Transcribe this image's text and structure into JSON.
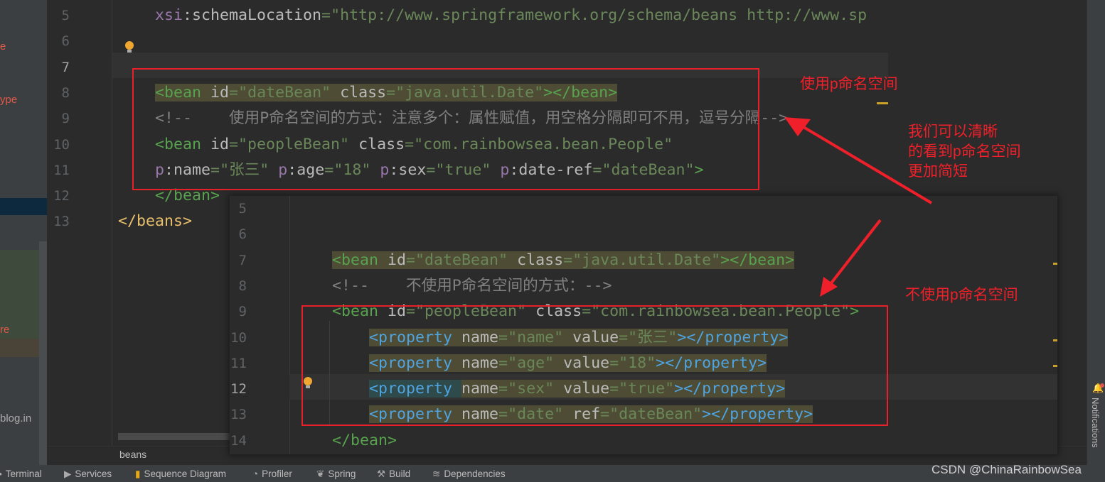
{
  "sidebar": {
    "fragments": [
      "e",
      "ype",
      "re",
      "blog.in"
    ]
  },
  "editor": {
    "line_numbers": [
      "5",
      "6",
      "7",
      "8",
      "9",
      "10",
      "11",
      "12",
      "13"
    ],
    "lines": [
      [
        [
          "attr",
          "    "
        ],
        [
          "ns",
          "xsi"
        ],
        [
          "attr",
          ":schemaLocation"
        ],
        [
          "eq",
          "="
        ],
        [
          "str",
          "\"http://www.springframework.org/schema/beans http://www.sp"
        ]
      ],
      [],
      [],
      [
        [
          "tag",
          "    <bean "
        ],
        [
          "attr",
          "id"
        ],
        [
          "eq",
          "="
        ],
        [
          "str",
          "\"dateBean\" "
        ],
        [
          "attr",
          "class"
        ],
        [
          "eq",
          "="
        ],
        [
          "str",
          "\"java.util.Date\""
        ],
        [
          "tag",
          "></bean>"
        ]
      ],
      [
        [
          "com",
          "    <!--    使用P命名空间的方式：注意多个：属性赋值，用空格分隔即可不用，逗号分隔-->"
        ]
      ],
      [
        [
          "tag",
          "    <bean "
        ],
        [
          "attr",
          "id"
        ],
        [
          "eq",
          "="
        ],
        [
          "str",
          "\"peopleBean\" "
        ],
        [
          "attr",
          "class"
        ],
        [
          "eq",
          "="
        ],
        [
          "str",
          "\"com.rainbowsea.bean.People\""
        ]
      ],
      [
        [
          "attr",
          "    "
        ],
        [
          "ns",
          "p"
        ],
        [
          "attr",
          ":name"
        ],
        [
          "eq",
          "="
        ],
        [
          "str",
          "\"张三\" "
        ],
        [
          "ns",
          "p"
        ],
        [
          "attr",
          ":age"
        ],
        [
          "eq",
          "="
        ],
        [
          "str",
          "\"18\" "
        ],
        [
          "ns",
          "p"
        ],
        [
          "attr",
          ":sex"
        ],
        [
          "eq",
          "="
        ],
        [
          "str",
          "\"true\" "
        ],
        [
          "ns",
          "p"
        ],
        [
          "attr",
          ":date-ref"
        ],
        [
          "eq",
          "="
        ],
        [
          "str",
          "\"dateBean\""
        ],
        [
          "tag",
          ">"
        ]
      ],
      [
        [
          "tag",
          "    </bean>"
        ]
      ],
      [
        [
          "root",
          "</beans>"
        ]
      ]
    ],
    "breadcrumb": "beans"
  },
  "popup": {
    "line_numbers": [
      "5",
      "6",
      "7",
      "8",
      "9",
      "10",
      "11",
      "12",
      "13",
      "14"
    ],
    "lines": [
      [],
      [],
      [
        [
          "tag",
          "<bean "
        ],
        [
          "attr",
          "id"
        ],
        [
          "eq",
          "="
        ],
        [
          "str",
          "\"dateBean\" "
        ],
        [
          "attr",
          "class"
        ],
        [
          "eq",
          "="
        ],
        [
          "str",
          "\"java.util.Date\""
        ],
        [
          "tag",
          "></bean>"
        ]
      ],
      [
        [
          "com",
          "<!--    不使用P命名空间的方式：-->"
        ]
      ],
      [
        [
          "tag",
          "<bean "
        ],
        [
          "attr",
          "id"
        ],
        [
          "eq",
          "="
        ],
        [
          "str",
          "\"peopleBean\" "
        ],
        [
          "attr",
          "class"
        ],
        [
          "eq",
          "="
        ],
        [
          "str",
          "\"com.rainbowsea.bean.People\""
        ],
        [
          "tag",
          ">"
        ]
      ],
      [
        [
          "prop",
          "    <property "
        ],
        [
          "attr",
          "name"
        ],
        [
          "eq",
          "="
        ],
        [
          "str",
          "\"name\" "
        ],
        [
          "attr",
          "value"
        ],
        [
          "eq",
          "="
        ],
        [
          "str",
          "\"张三\""
        ],
        [
          "prop",
          "></property>"
        ]
      ],
      [
        [
          "prop",
          "    <property "
        ],
        [
          "attr",
          "name"
        ],
        [
          "eq",
          "="
        ],
        [
          "str",
          "\"age\" "
        ],
        [
          "attr",
          "value"
        ],
        [
          "eq",
          "="
        ],
        [
          "str",
          "\"18\""
        ],
        [
          "prop",
          "></property>"
        ]
      ],
      [
        [
          "prop",
          "    <property "
        ],
        [
          "attr",
          "name"
        ],
        [
          "eq",
          "="
        ],
        [
          "str",
          "\"sex\" "
        ],
        [
          "attr",
          "value"
        ],
        [
          "eq",
          "="
        ],
        [
          "str",
          "\"true\""
        ],
        [
          "prop",
          "></property>"
        ]
      ],
      [
        [
          "prop",
          "    <property "
        ],
        [
          "attr",
          "name"
        ],
        [
          "eq",
          "="
        ],
        [
          "str",
          "\"date\" "
        ],
        [
          "attr",
          "ref"
        ],
        [
          "eq",
          "="
        ],
        [
          "str",
          "\"dateBean\""
        ],
        [
          "prop",
          "></property>"
        ]
      ],
      [
        [
          "tag",
          "</bean>"
        ]
      ]
    ]
  },
  "annotations": {
    "use_p": "使用p命名空间",
    "clearer": [
      "我们可以清晰",
      "的看到p命名空间",
      "更加简短"
    ],
    "no_p": "不使用p命名空间"
  },
  "bottombar": {
    "tools": [
      {
        "label": "Terminal",
        "icon": "terminal-icon"
      },
      {
        "label": "Services",
        "icon": "services-icon"
      },
      {
        "label": "Sequence Diagram",
        "icon": "sequence-diagram-icon"
      },
      {
        "label": "Profiler",
        "icon": "profiler-icon"
      },
      {
        "label": "Spring",
        "icon": "spring-icon"
      },
      {
        "label": "Build",
        "icon": "hammer-icon"
      },
      {
        "label": "Dependencies",
        "icon": "dependencies-icon"
      }
    ],
    "watermark": "CSDN @ChinaRainbowSea"
  },
  "rightstrip": {
    "notifications": "Notifications"
  },
  "colors": {
    "annotation": "#f0202a",
    "tag": "#58a24f",
    "string": "#6a8759",
    "property": "#4ea3e0",
    "highlight": "#4e4c34"
  }
}
